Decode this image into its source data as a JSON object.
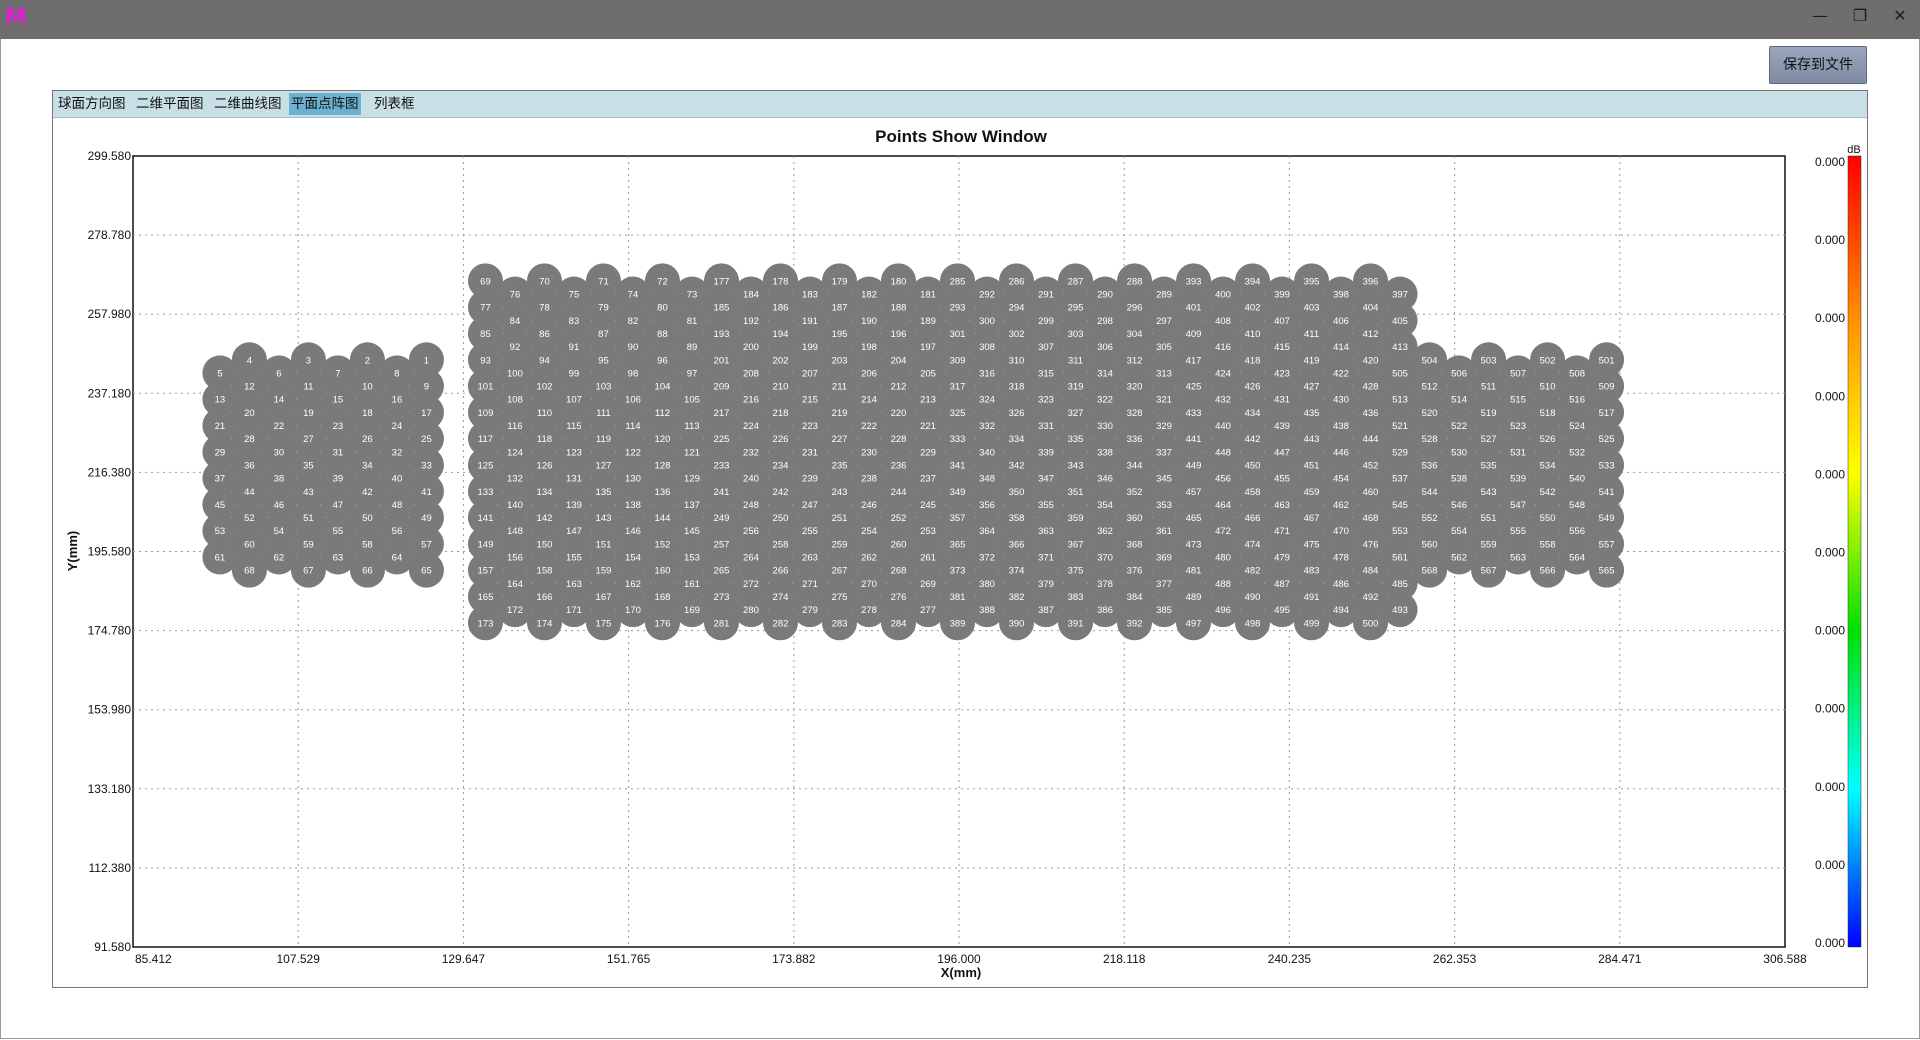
{
  "window": {
    "icon": "app-logo-icon",
    "minimize_glyph": "—",
    "restore_glyph": "❐",
    "close_glyph": "✕"
  },
  "toolbar": {
    "save_label": "保存到文件"
  },
  "tabs": [
    {
      "label": "球面方向图",
      "active": false
    },
    {
      "label": "二维平面图",
      "active": false
    },
    {
      "label": "二维曲线图",
      "active": false
    },
    {
      "label": "平面点阵图",
      "active": true
    },
    {
      "label": "列表框",
      "active": false
    }
  ],
  "chart_data": {
    "type": "scatter",
    "title": "Points Show Window",
    "xlabel": "X(mm)",
    "ylabel": "Y(mm)",
    "xlim": [
      85.412,
      306.588
    ],
    "ylim": [
      91.58,
      299.58
    ],
    "x_ticks": [
      "85.412",
      "107.529",
      "129.647",
      "151.765",
      "173.882",
      "196.000",
      "218.118",
      "240.235",
      "262.353",
      "284.471",
      "306.588"
    ],
    "y_ticks": [
      "91.580",
      "112.380",
      "133.180",
      "153.980",
      "174.780",
      "195.580",
      "216.380",
      "237.180",
      "257.980",
      "278.780",
      "299.580"
    ],
    "grid": true,
    "point_color": "#7a7a7a",
    "label_color": "#ffffff",
    "colorbar": {
      "unit": "dB",
      "labels": [
        "0.000",
        "0.000",
        "0.000",
        "0.000",
        "0.000",
        "0.000",
        "0.000",
        "0.000",
        "0.000",
        "0.000",
        "0.000"
      ],
      "colors": [
        "#ff0000",
        "#ff8c00",
        "#ffff00",
        "#00e000",
        "#00ffff",
        "#0000ff"
      ]
    },
    "dx_mm": 3.95,
    "dy_mm": 3.458,
    "points": [
      [
        101.0,
        246.0,
        [
          4,
          3,
          2,
          1
        ]
      ],
      [
        97.05,
        242.54,
        [
          5,
          6,
          7,
          8
        ]
      ],
      [
        101.0,
        239.08,
        [
          12,
          11,
          10,
          9
        ]
      ],
      [
        97.05,
        235.63,
        [
          13,
          14,
          15,
          16
        ]
      ],
      [
        101.0,
        232.17,
        [
          20,
          19,
          18,
          17
        ]
      ],
      [
        97.05,
        228.71,
        [
          21,
          22,
          23,
          24
        ]
      ],
      [
        101.0,
        225.25,
        [
          28,
          27,
          26,
          25
        ]
      ],
      [
        97.05,
        221.79,
        [
          29,
          30,
          31,
          32
        ]
      ],
      [
        101.0,
        218.33,
        [
          36,
          35,
          34,
          33
        ]
      ],
      [
        97.05,
        214.88,
        [
          37,
          38,
          39,
          40
        ]
      ],
      [
        101.0,
        211.42,
        [
          44,
          43,
          42,
          41
        ]
      ],
      [
        97.05,
        207.96,
        [
          45,
          46,
          47,
          48
        ]
      ],
      [
        101.0,
        204.5,
        [
          52,
          51,
          50,
          49
        ]
      ],
      [
        97.05,
        201.04,
        [
          53,
          54,
          55,
          56
        ]
      ],
      [
        101.0,
        197.58,
        [
          60,
          59,
          58,
          57
        ]
      ],
      [
        97.05,
        194.13,
        [
          61,
          62,
          63,
          64
        ]
      ],
      [
        101.0,
        190.67,
        [
          68,
          67,
          66,
          65
        ]
      ],
      [
        132.6,
        266.75,
        [
          69,
          70,
          71,
          72
        ]
      ],
      [
        136.55,
        263.29,
        [
          76,
          75,
          74,
          73
        ]
      ],
      [
        132.6,
        259.83,
        [
          77,
          78,
          79,
          80
        ]
      ],
      [
        136.55,
        256.38,
        [
          84,
          83,
          82,
          81
        ]
      ],
      [
        132.6,
        252.92,
        [
          85,
          86,
          87,
          88
        ]
      ],
      [
        136.55,
        249.46,
        [
          92,
          91,
          90,
          89
        ]
      ],
      [
        132.6,
        246.0,
        [
          93,
          94,
          95,
          96
        ]
      ],
      [
        136.55,
        242.54,
        [
          100,
          99,
          98,
          97
        ]
      ],
      [
        132.6,
        239.08,
        [
          101,
          102,
          103,
          104
        ]
      ],
      [
        136.55,
        235.63,
        [
          108,
          107,
          106,
          105
        ]
      ],
      [
        132.6,
        232.17,
        [
          109,
          110,
          111,
          112
        ]
      ],
      [
        136.55,
        228.71,
        [
          116,
          115,
          114,
          113
        ]
      ],
      [
        132.6,
        225.25,
        [
          117,
          118,
          119,
          120
        ]
      ],
      [
        136.55,
        221.79,
        [
          124,
          123,
          122,
          121
        ]
      ],
      [
        132.6,
        218.33,
        [
          125,
          126,
          127,
          128
        ]
      ],
      [
        136.55,
        214.88,
        [
          132,
          131,
          130,
          129
        ]
      ],
      [
        132.6,
        211.42,
        [
          133,
          134,
          135,
          136
        ]
      ],
      [
        136.55,
        207.96,
        [
          140,
          139,
          138,
          137
        ]
      ],
      [
        132.6,
        204.5,
        [
          141,
          142,
          143,
          144
        ]
      ],
      [
        136.55,
        201.04,
        [
          148,
          147,
          146,
          145
        ]
      ],
      [
        132.6,
        197.58,
        [
          149,
          150,
          151,
          152
        ]
      ],
      [
        136.55,
        194.13,
        [
          156,
          155,
          154,
          153
        ]
      ],
      [
        132.6,
        190.67,
        [
          157,
          158,
          159,
          160
        ]
      ],
      [
        136.55,
        187.21,
        [
          164,
          163,
          162,
          161
        ]
      ],
      [
        132.6,
        183.75,
        [
          165,
          166,
          167,
          168
        ]
      ],
      [
        136.55,
        180.29,
        [
          172,
          171,
          170,
          169
        ]
      ],
      [
        132.6,
        176.83,
        [
          173,
          174,
          175,
          176
        ]
      ],
      [
        164.2,
        266.75,
        [
          177,
          178,
          179,
          180
        ]
      ],
      [
        168.15,
        263.29,
        [
          184,
          183,
          182,
          181
        ]
      ],
      [
        164.2,
        259.83,
        [
          185,
          186,
          187,
          188
        ]
      ],
      [
        168.15,
        256.38,
        [
          192,
          191,
          190,
          189
        ]
      ],
      [
        164.2,
        252.92,
        [
          193,
          194,
          195,
          196
        ]
      ],
      [
        168.15,
        249.46,
        [
          200,
          199,
          198,
          197
        ]
      ],
      [
        164.2,
        246.0,
        [
          201,
          202,
          203,
          204
        ]
      ],
      [
        168.15,
        242.54,
        [
          208,
          207,
          206,
          205
        ]
      ],
      [
        164.2,
        239.08,
        [
          209,
          210,
          211,
          212
        ]
      ],
      [
        168.15,
        235.63,
        [
          216,
          215,
          214,
          213
        ]
      ],
      [
        164.2,
        232.17,
        [
          217,
          218,
          219,
          220
        ]
      ],
      [
        168.15,
        228.71,
        [
          224,
          223,
          222,
          221
        ]
      ],
      [
        164.2,
        225.25,
        [
          225,
          226,
          227,
          228
        ]
      ],
      [
        168.15,
        221.79,
        [
          232,
          231,
          230,
          229
        ]
      ],
      [
        164.2,
        218.33,
        [
          233,
          234,
          235,
          236
        ]
      ],
      [
        168.15,
        214.88,
        [
          240,
          239,
          238,
          237
        ]
      ],
      [
        164.2,
        211.42,
        [
          241,
          242,
          243,
          244
        ]
      ],
      [
        168.15,
        207.96,
        [
          248,
          247,
          246,
          245
        ]
      ],
      [
        164.2,
        204.5,
        [
          249,
          250,
          251,
          252
        ]
      ],
      [
        168.15,
        201.04,
        [
          256,
          255,
          254,
          253
        ]
      ],
      [
        164.2,
        197.58,
        [
          257,
          258,
          259,
          260
        ]
      ],
      [
        168.15,
        194.13,
        [
          264,
          263,
          262,
          261
        ]
      ],
      [
        164.2,
        190.67,
        [
          265,
          266,
          267,
          268
        ]
      ],
      [
        168.15,
        187.21,
        [
          272,
          271,
          270,
          269
        ]
      ],
      [
        164.2,
        183.75,
        [
          273,
          274,
          275,
          276
        ]
      ],
      [
        168.15,
        180.29,
        [
          280,
          279,
          278,
          277
        ]
      ],
      [
        164.2,
        176.83,
        [
          281,
          282,
          283,
          284
        ]
      ],
      [
        195.8,
        266.75,
        [
          285,
          286,
          287,
          288
        ]
      ],
      [
        199.75,
        263.29,
        [
          292,
          291,
          290,
          289
        ]
      ],
      [
        195.8,
        259.83,
        [
          293,
          294,
          295,
          296
        ]
      ],
      [
        199.75,
        256.38,
        [
          300,
          299,
          298,
          297
        ]
      ],
      [
        195.8,
        252.92,
        [
          301,
          302,
          303,
          304
        ]
      ],
      [
        199.75,
        249.46,
        [
          308,
          307,
          306,
          305
        ]
      ],
      [
        195.8,
        246.0,
        [
          309,
          310,
          311,
          312
        ]
      ],
      [
        199.75,
        242.54,
        [
          316,
          315,
          314,
          313
        ]
      ],
      [
        195.8,
        239.08,
        [
          317,
          318,
          319,
          320
        ]
      ],
      [
        199.75,
        235.63,
        [
          324,
          323,
          322,
          321
        ]
      ],
      [
        195.8,
        232.17,
        [
          325,
          326,
          327,
          328
        ]
      ],
      [
        199.75,
        228.71,
        [
          332,
          331,
          330,
          329
        ]
      ],
      [
        195.8,
        225.25,
        [
          333,
          334,
          335,
          336
        ]
      ],
      [
        199.75,
        221.79,
        [
          340,
          339,
          338,
          337
        ]
      ],
      [
        195.8,
        218.33,
        [
          341,
          342,
          343,
          344
        ]
      ],
      [
        199.75,
        214.88,
        [
          348,
          347,
          346,
          345
        ]
      ],
      [
        195.8,
        211.42,
        [
          349,
          350,
          351,
          352
        ]
      ],
      [
        199.75,
        207.96,
        [
          356,
          355,
          354,
          353
        ]
      ],
      [
        195.8,
        204.5,
        [
          357,
          358,
          359,
          360
        ]
      ],
      [
        199.75,
        201.04,
        [
          364,
          363,
          362,
          361
        ]
      ],
      [
        195.8,
        197.58,
        [
          365,
          366,
          367,
          368
        ]
      ],
      [
        199.75,
        194.13,
        [
          372,
          371,
          370,
          369
        ]
      ],
      [
        195.8,
        190.67,
        [
          373,
          374,
          375,
          376
        ]
      ],
      [
        199.75,
        187.21,
        [
          380,
          379,
          378,
          377
        ]
      ],
      [
        195.8,
        183.75,
        [
          381,
          382,
          383,
          384
        ]
      ],
      [
        199.75,
        180.29,
        [
          388,
          387,
          386,
          385
        ]
      ],
      [
        195.8,
        176.83,
        [
          389,
          390,
          391,
          392
        ]
      ],
      [
        227.4,
        266.75,
        [
          393,
          394,
          395,
          396
        ]
      ],
      [
        231.35,
        263.29,
        [
          400,
          399,
          398,
          397
        ]
      ],
      [
        227.4,
        259.83,
        [
          401,
          402,
          403,
          404
        ]
      ],
      [
        231.35,
        256.38,
        [
          408,
          407,
          406,
          405
        ]
      ],
      [
        227.4,
        252.92,
        [
          409,
          410,
          411,
          412
        ]
      ],
      [
        231.35,
        249.46,
        [
          416,
          415,
          414,
          413
        ]
      ],
      [
        227.4,
        246.0,
        [
          417,
          418,
          419,
          420
        ]
      ],
      [
        231.35,
        242.54,
        [
          424,
          423,
          422,
          421
        ]
      ],
      [
        227.4,
        239.08,
        [
          425,
          426,
          427,
          428
        ]
      ],
      [
        231.35,
        235.63,
        [
          432,
          431,
          430,
          429
        ]
      ],
      [
        227.4,
        232.17,
        [
          433,
          434,
          435,
          436
        ]
      ],
      [
        231.35,
        228.71,
        [
          440,
          439,
          438,
          437
        ]
      ],
      [
        227.4,
        225.25,
        [
          441,
          442,
          443,
          444
        ]
      ],
      [
        231.35,
        221.79,
        [
          448,
          447,
          446,
          445
        ]
      ],
      [
        227.4,
        218.33,
        [
          449,
          450,
          451,
          452
        ]
      ],
      [
        231.35,
        214.88,
        [
          456,
          455,
          454,
          453
        ]
      ],
      [
        227.4,
        211.42,
        [
          457,
          458,
          459,
          460
        ]
      ],
      [
        231.35,
        207.96,
        [
          464,
          463,
          462,
          461
        ]
      ],
      [
        227.4,
        204.5,
        [
          465,
          466,
          467,
          468
        ]
      ],
      [
        231.35,
        201.04,
        [
          472,
          471,
          470,
          469
        ]
      ],
      [
        227.4,
        197.58,
        [
          473,
          474,
          475,
          476
        ]
      ],
      [
        231.35,
        194.13,
        [
          480,
          479,
          478,
          477
        ]
      ],
      [
        227.4,
        190.67,
        [
          481,
          482,
          483,
          484
        ]
      ],
      [
        231.35,
        187.21,
        [
          488,
          487,
          486,
          485
        ]
      ],
      [
        227.4,
        183.75,
        [
          489,
          490,
          491,
          492
        ]
      ],
      [
        231.35,
        180.29,
        [
          496,
          495,
          494,
          493
        ]
      ],
      [
        227.4,
        176.83,
        [
          497,
          498,
          499,
          500
        ]
      ],
      [
        259.0,
        246.0,
        [
          504,
          503,
          502,
          501
        ]
      ],
      [
        255.05,
        242.54,
        [
          505,
          506,
          507,
          508
        ]
      ],
      [
        259.0,
        239.08,
        [
          512,
          511,
          510,
          509
        ]
      ],
      [
        255.05,
        235.63,
        [
          513,
          514,
          515,
          516
        ]
      ],
      [
        259.0,
        232.17,
        [
          520,
          519,
          518,
          517
        ]
      ],
      [
        255.05,
        228.71,
        [
          521,
          522,
          523,
          524
        ]
      ],
      [
        259.0,
        225.25,
        [
          528,
          527,
          526,
          525
        ]
      ],
      [
        255.05,
        221.79,
        [
          529,
          530,
          531,
          532
        ]
      ],
      [
        259.0,
        218.33,
        [
          536,
          535,
          534,
          533
        ]
      ],
      [
        255.05,
        214.88,
        [
          537,
          538,
          539,
          540
        ]
      ],
      [
        259.0,
        211.42,
        [
          544,
          543,
          542,
          541
        ]
      ],
      [
        255.05,
        207.96,
        [
          545,
          546,
          547,
          548
        ]
      ],
      [
        259.0,
        204.5,
        [
          552,
          551,
          550,
          549
        ]
      ],
      [
        255.05,
        201.04,
        [
          553,
          554,
          555,
          556
        ]
      ],
      [
        259.0,
        197.58,
        [
          560,
          559,
          558,
          557
        ]
      ],
      [
        255.05,
        194.13,
        [
          561,
          562,
          563,
          564
        ]
      ],
      [
        259.0,
        190.67,
        [
          568,
          567,
          566,
          565
        ]
      ]
    ]
  }
}
